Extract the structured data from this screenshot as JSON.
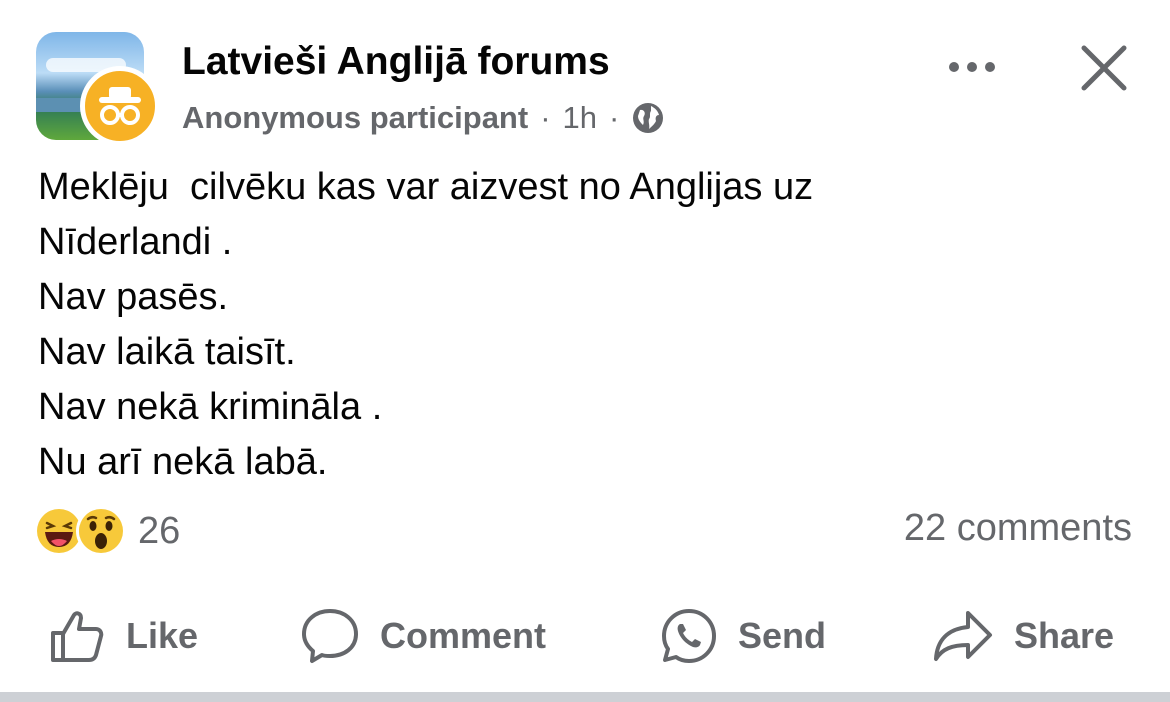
{
  "post": {
    "group_name": "Latvieši Anglijā forums",
    "author": "Anonymous participant",
    "separator": "·",
    "time": "1h",
    "audience_icon": "globe-icon",
    "more_icon": "more-horizontal-icon",
    "close_icon": "close-icon",
    "body_lines": [
      "Meklēju  cilvēku kas var aizvest no Anglijas uz",
      "Nīderlandi .",
      "Nav pasēs.",
      "Nav laikā taisīt.",
      "Nav nekā krimināla .",
      "Nu arī nekā labā."
    ]
  },
  "reactions": {
    "icons": [
      "haha-reaction-icon",
      "wow-reaction-icon"
    ],
    "count": "26",
    "comments_label": "22 comments"
  },
  "actions": {
    "like": "Like",
    "comment": "Comment",
    "send": "Send",
    "share": "Share"
  },
  "colors": {
    "text_primary": "#050505",
    "text_secondary": "#65676b",
    "anon_badge": "#f7b125",
    "reaction_yellow": "#f7c93a",
    "divider": "#cdd0d5"
  }
}
